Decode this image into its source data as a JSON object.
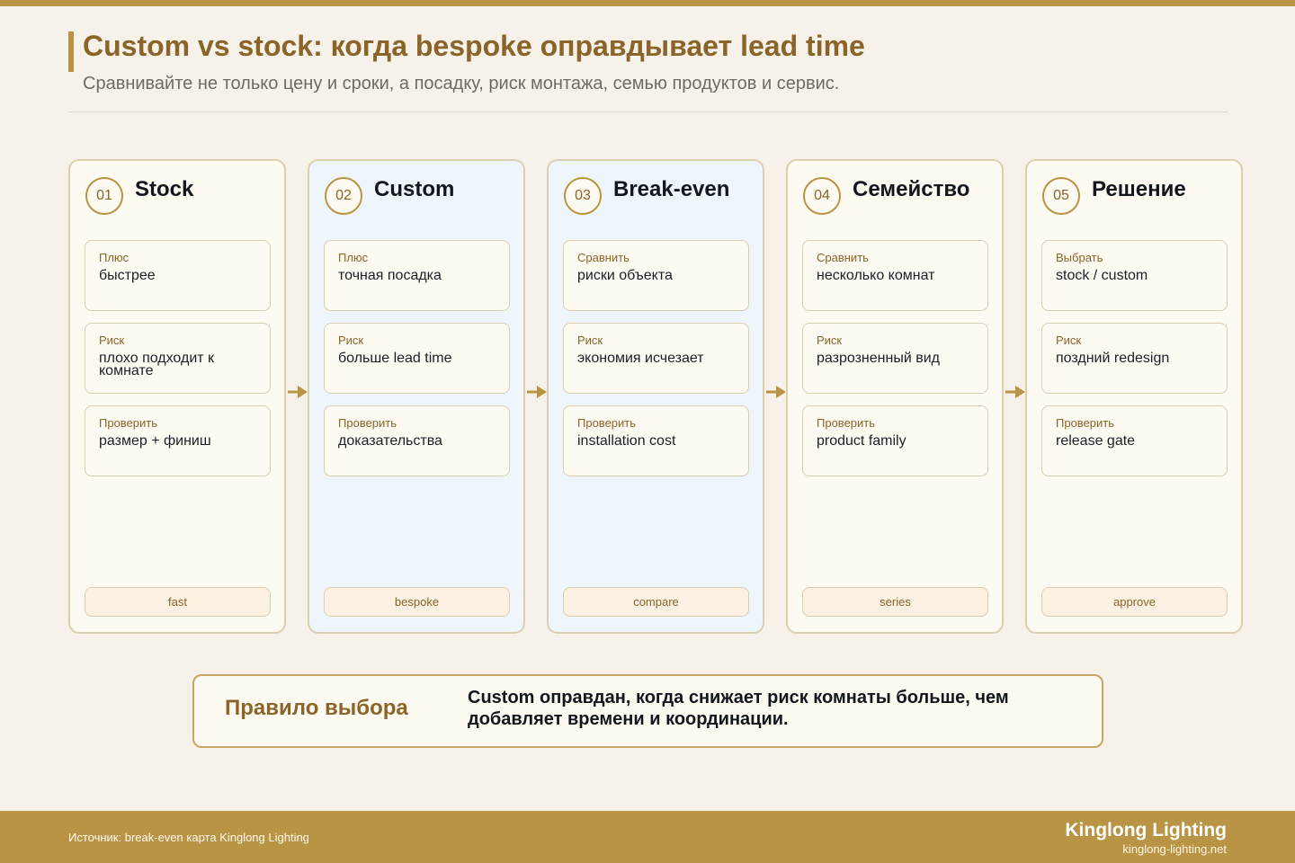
{
  "header": {
    "title": "Custom vs stock: когда bespoke оправдывает lead time",
    "subtitle": "Сравнивайте не только цену и сроки, а посадку, риск монтажа, семью продуктов и сервис."
  },
  "columns": [
    {
      "step": "01",
      "title": "Stock",
      "cards": [
        {
          "label": "Плюс",
          "value": "быстрее"
        },
        {
          "label": "Риск",
          "value": "плохо подходит к комнате"
        },
        {
          "label": "Проверить",
          "value": "размер + финиш"
        }
      ],
      "tag": "fast"
    },
    {
      "step": "02",
      "title": "Custom",
      "cards": [
        {
          "label": "Плюс",
          "value": "точная посадка"
        },
        {
          "label": "Риск",
          "value": "больше lead time"
        },
        {
          "label": "Проверить",
          "value": "доказательства"
        }
      ],
      "tag": "bespoke"
    },
    {
      "step": "03",
      "title": "Break-even",
      "cards": [
        {
          "label": "Сравнить",
          "value": "риски объекта"
        },
        {
          "label": "Риск",
          "value": "экономия исчезает"
        },
        {
          "label": "Проверить",
          "value": "installation cost"
        }
      ],
      "tag": "compare"
    },
    {
      "step": "04",
      "title": "Семейство",
      "cards": [
        {
          "label": "Сравнить",
          "value": "несколько комнат"
        },
        {
          "label": "Риск",
          "value": "разрозненный вид"
        },
        {
          "label": "Проверить",
          "value": "product family"
        }
      ],
      "tag": "series"
    },
    {
      "step": "05",
      "title": "Решение",
      "cards": [
        {
          "label": "Выбрать",
          "value": "stock / custom"
        },
        {
          "label": "Риск",
          "value": "поздний redesign"
        },
        {
          "label": "Проверить",
          "value": "release gate"
        }
      ],
      "tag": "approve"
    }
  ],
  "rule": {
    "title": "Правило выбора",
    "text": "Custom оправдан, когда снижает риск комнаты больше, чем добавляет времени и координации."
  },
  "footer": {
    "source": "Источник: break-even карта Kinglong Lighting",
    "brand": "Kinglong Lighting",
    "url": "kinglong-lighting.net"
  },
  "colors": {
    "accent": "#b99444",
    "title": "#8a6428",
    "background": "#f6f2ea",
    "card": "#fdfaf2",
    "highlight_column": "#eef6fb",
    "border": "#dccfb1"
  }
}
